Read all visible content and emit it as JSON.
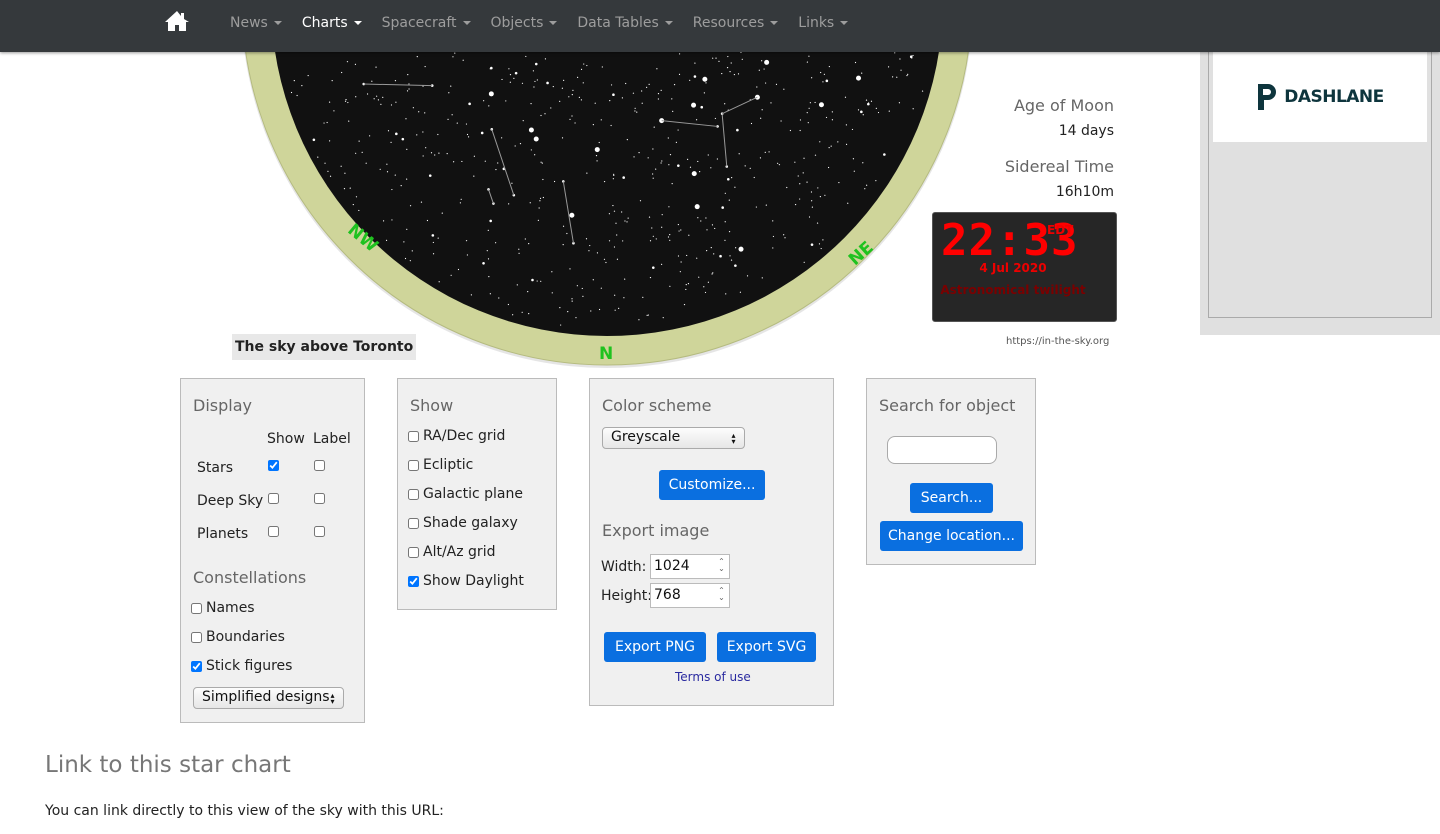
{
  "nav": {
    "items": [
      {
        "label": "News"
      },
      {
        "label": "Charts",
        "active": true
      },
      {
        "label": "Spacecraft"
      },
      {
        "label": "Objects"
      },
      {
        "label": "Data Tables"
      },
      {
        "label": "Resources"
      },
      {
        "label": "Links"
      }
    ]
  },
  "sky": {
    "caption": "The sky above Toronto",
    "directions": {
      "nw": "NW",
      "n": "N",
      "ne": "NE"
    },
    "colors": {
      "ring": "#cfd59a",
      "sky": "#111111",
      "direction": "#1fc21f"
    }
  },
  "info": {
    "moon_label": "Age of Moon",
    "moon_value": "14 days",
    "sidereal_label": "Sidereal Time",
    "sidereal_value": "16h10m"
  },
  "clock": {
    "time": "22:33",
    "tz": "EDT",
    "date": "4 Jul 2020",
    "phase": "Astronomical twilight"
  },
  "credit": "https://in-the-sky.org",
  "ad": {
    "brand": "DASHLANE"
  },
  "display": {
    "title": "Display",
    "col_show": "Show",
    "col_label": "Label",
    "rows": [
      {
        "label": "Stars",
        "show": true,
        "labelled": false
      },
      {
        "label": "Deep Sky",
        "show": false,
        "labelled": false
      },
      {
        "label": "Planets",
        "show": false,
        "labelled": false
      }
    ],
    "const_title": "Constellations",
    "const": [
      {
        "label": "Names",
        "checked": false
      },
      {
        "label": "Boundaries",
        "checked": false
      },
      {
        "label": "Stick figures",
        "checked": true
      }
    ],
    "design": "Simplified designs"
  },
  "show": {
    "title": "Show",
    "items": [
      {
        "label": "RA/Dec grid",
        "checked": false
      },
      {
        "label": "Ecliptic",
        "checked": false
      },
      {
        "label": "Galactic plane",
        "checked": false
      },
      {
        "label": "Shade galaxy",
        "checked": false
      },
      {
        "label": "Alt/Az grid",
        "checked": false
      },
      {
        "label": "Show Daylight",
        "checked": true
      }
    ]
  },
  "color": {
    "title": "Color scheme",
    "scheme": "Greyscale",
    "customize": "Customize...",
    "export_title": "Export image",
    "width_label": "Width:",
    "width": "1024",
    "height_label": "Height:",
    "height": "768",
    "png": "Export PNG",
    "svg": "Export SVG",
    "terms": "Terms of use"
  },
  "search": {
    "title": "Search for object",
    "placeholder": "",
    "search": "Search...",
    "location": "Change location..."
  },
  "link": {
    "title": "Link to this star chart",
    "text": "You can link directly to this view of the sky with this URL:"
  }
}
